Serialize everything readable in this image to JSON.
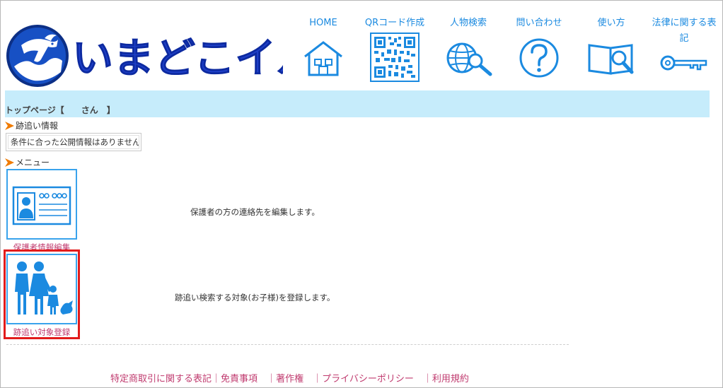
{
  "header": {
    "brand_text": "いまどこイルカ",
    "nav": [
      {
        "label": "HOME",
        "icon": "house-icon"
      },
      {
        "label": "QRコード作成",
        "icon": "qr-code-icon"
      },
      {
        "label": "人物検索",
        "icon": "globe-search-icon"
      },
      {
        "label": "問い合わせ",
        "icon": "question-circle-icon"
      },
      {
        "label": "使い方",
        "icon": "book-magnifier-icon"
      },
      {
        "label": "法律に関する表記",
        "icon": "key-icon"
      }
    ],
    "accent_color": "#1b8ae0"
  },
  "breadcrumb": "トップページ【　　さん　】",
  "tracking": {
    "heading": "跡追い情報",
    "empty_message": "条件に合った公開情報はありません"
  },
  "menu": {
    "heading": "メニュー",
    "items": [
      {
        "caption": "保護者情報編集",
        "description": "保護者の方の連絡先を編集します。",
        "icon": "id-card-icon"
      },
      {
        "caption": "跡追い対象登録",
        "description": "跡追い検索する対象(お子様)を登録します。",
        "icon": "family-icon"
      }
    ]
  },
  "footer": {
    "links": [
      "特定商取引に関する表記",
      "免責事項",
      "著作権",
      "プライバシーポリシー",
      "利用規約"
    ],
    "link_color": "#c03b6f"
  }
}
